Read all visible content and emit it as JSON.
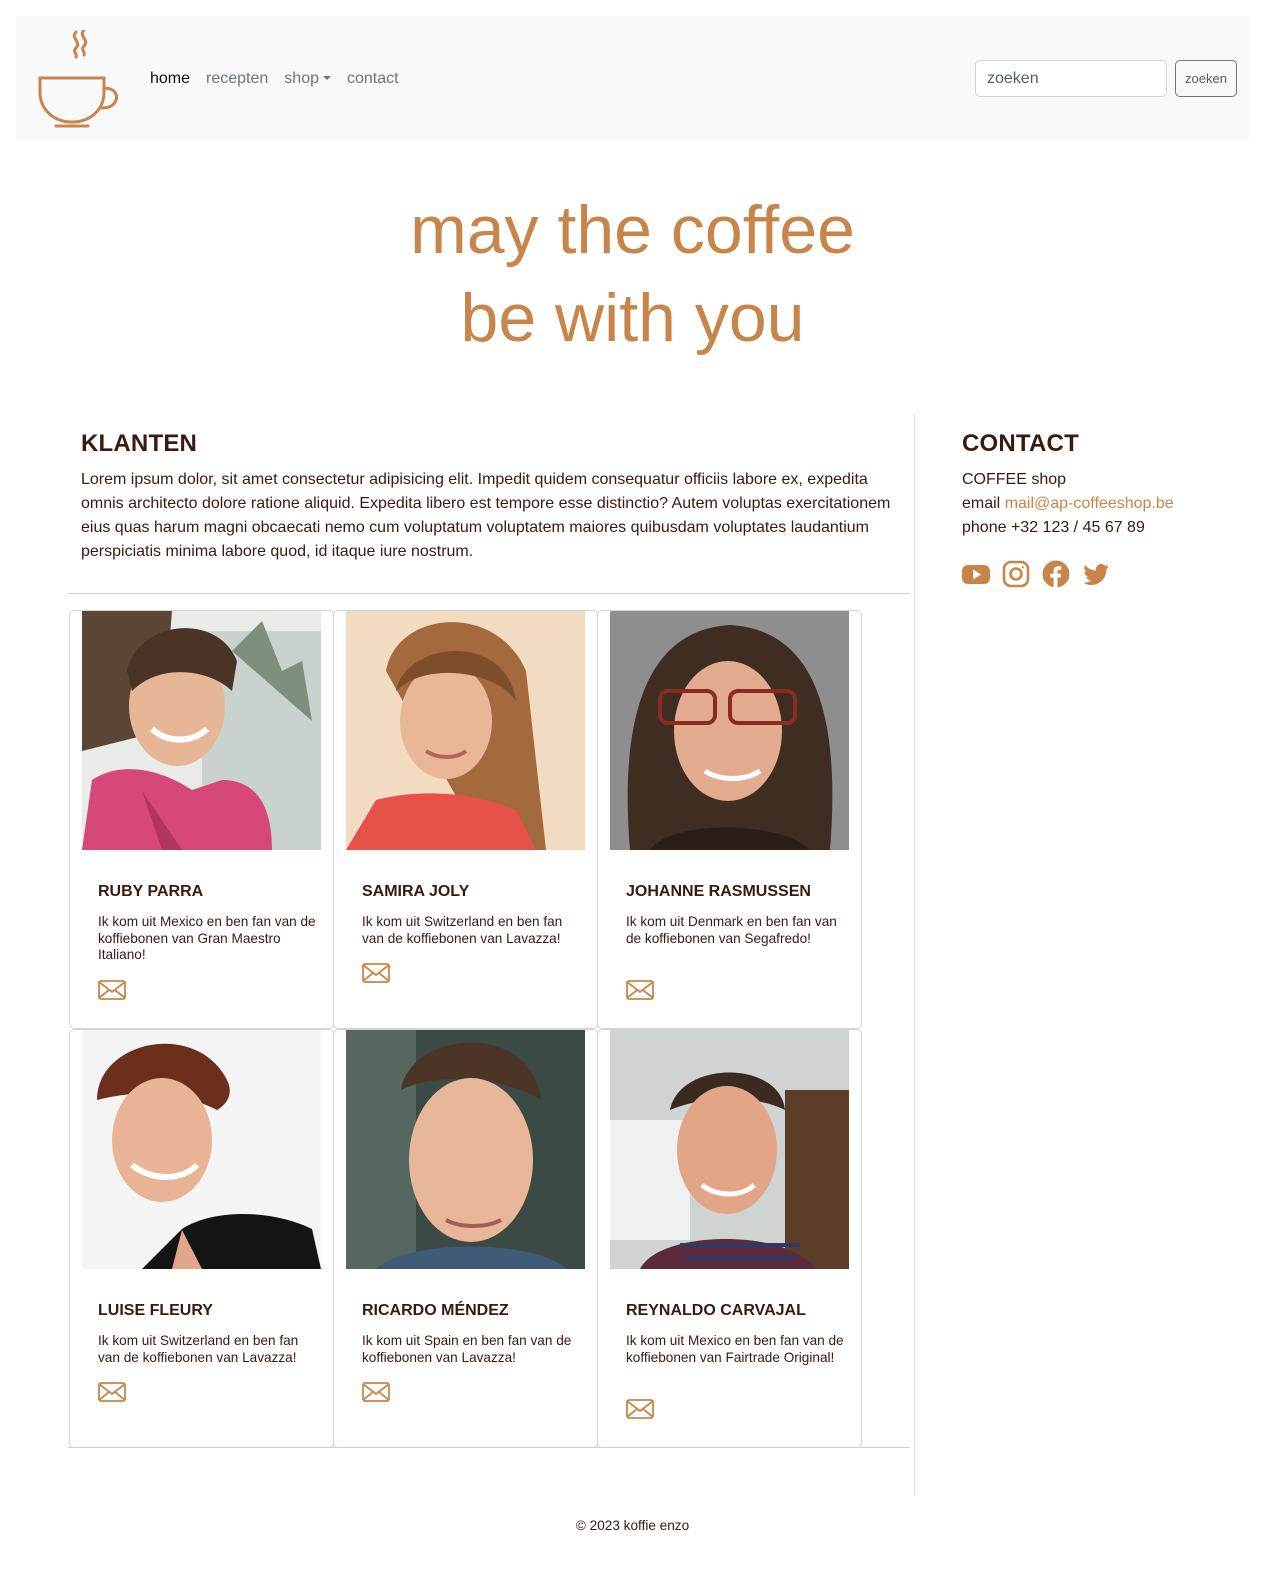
{
  "nav": {
    "links": [
      "home",
      "recepten",
      "shop",
      "contact"
    ],
    "search_placeholder": "zoeken",
    "search_button": "zoeken"
  },
  "hero": {
    "line1": "may the coffee",
    "line2": "be with you"
  },
  "clients": {
    "title": "KLANTEN",
    "intro": "Lorem ipsum dolor, sit amet consectetur adipisicing elit. Impedit quidem consequatur officiis labore ex, expedita omnis architecto dolore ratione aliquid. Expedita libero est tempore esse distinctio? Autem voluptas exercitationem eius quas harum magni obcaecati nemo cum voluptatum voluptatem maiores quibusdam voluptates laudantium perspiciatis minima labore quod, id itaque iure nostrum.",
    "cards": [
      {
        "name": "Ruby Parra",
        "text": "Ik kom uit Mexico en ben fan van de koffiebonen van Gran Maestro Italiano!"
      },
      {
        "name": "Samira Joly",
        "text": "Ik kom uit Switzerland en ben fan van de koffiebonen van Lavazza!"
      },
      {
        "name": "Johanne Rasmussen",
        "text": "Ik kom uit Denmark en ben fan van de koffiebonen van Segafredo!"
      },
      {
        "name": "Luise Fleury",
        "text": "Ik kom uit Switzerland en ben fan van de koffiebonen van Lavazza!"
      },
      {
        "name": "Ricardo Méndez",
        "text": "Ik kom uit Spain en ben fan van de koffiebonen van Lavazza!"
      },
      {
        "name": "Reynaldo Carvajal",
        "text": "Ik kom uit Mexico en ben fan van de koffiebonen van Fairtrade Original!"
      }
    ]
  },
  "contact": {
    "title": "CONTACT",
    "shop": "COFFEE shop",
    "email_label": "email",
    "email": "mail@ap-coffeeshop.be",
    "phone_label": "phone",
    "phone": "+32 123 / 45 67 89",
    "socials": [
      "youtube-icon",
      "instagram-icon",
      "facebook-icon",
      "twitter-icon"
    ]
  },
  "footer": {
    "text": "© 2023 koffie enzo"
  },
  "colors": {
    "accent": "#c8854a",
    "text": "#3a1a0e",
    "navbar_bg": "#f8f9fa"
  }
}
